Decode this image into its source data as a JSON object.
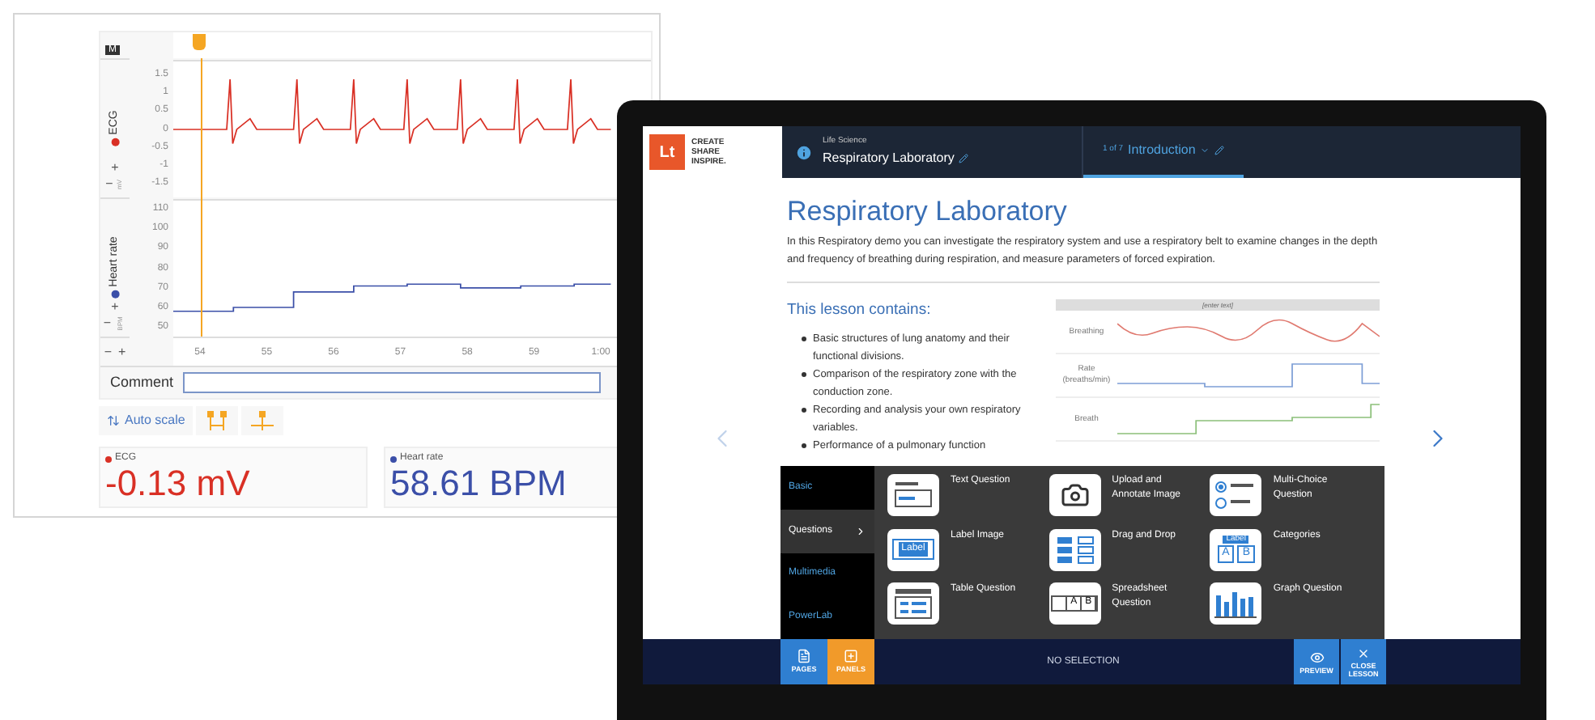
{
  "recorder": {
    "badge": "M",
    "ecg": {
      "color": "#d93025",
      "unit": "mV",
      "chart_data": {
        "type": "line",
        "x": [
          53.6,
          54.4,
          54.45,
          54.49,
          54.55,
          54.75,
          54.85,
          55.4,
          55.45,
          55.49,
          55.55,
          55.75,
          55.85,
          56.25,
          56.3,
          56.34,
          56.4,
          56.6,
          56.7,
          57.05,
          57.1,
          57.14,
          57.2,
          57.4,
          57.5,
          57.85,
          57.9,
          57.94,
          58.0,
          58.2,
          58.3,
          58.7,
          58.75,
          58.79,
          58.85,
          59.05,
          59.15,
          59.5,
          59.55,
          59.59,
          59.65,
          59.85,
          59.95,
          60.15
        ],
        "series": [
          {
            "name": "ECG",
            "color": "#d93025",
            "values": [
              0,
              0,
              1.4,
              -0.4,
              0,
              0.3,
              0,
              0,
              1.4,
              -0.4,
              0,
              0.3,
              0,
              0,
              1.4,
              -0.4,
              0,
              0.3,
              0,
              0,
              1.4,
              -0.4,
              0,
              0.3,
              0,
              0,
              1.4,
              -0.4,
              0,
              0.3,
              0,
              0,
              1.4,
              -0.4,
              0,
              0.3,
              0,
              0,
              1.4,
              -0.4,
              0,
              0.3,
              0,
              0
            ]
          }
        ],
        "xlim": [
          53.6,
          60.75
        ],
        "ylim": [
          -1.9,
          1.9
        ],
        "yticks": [
          1.5,
          1,
          0.5,
          0,
          -0.5,
          -1,
          -1.5
        ]
      }
    },
    "heart_rate": {
      "color": "#3b4fa8",
      "unit": "BPM",
      "chart_data": {
        "type": "line",
        "x": [
          53.6,
          54.5,
          54.5,
          55.4,
          55.4,
          56.3,
          56.3,
          57.1,
          57.1,
          57.9,
          57.9,
          58.8,
          58.8,
          59.6,
          59.6,
          60.15
        ],
        "series": [
          {
            "name": "Heart rate",
            "color": "#3b4fa8",
            "values": [
              58,
              58,
              60,
              60,
              68,
              68,
              71,
              71,
              72,
              72,
              70,
              70,
              71,
              71,
              72,
              72
            ]
          }
        ],
        "xlim": [
          53.6,
          60.75
        ],
        "ylim": [
          45,
          115
        ],
        "yticks": [
          110,
          100,
          90,
          80,
          70,
          60,
          50
        ],
        "xticks": [
          54,
          55,
          56,
          57,
          58,
          59,
          {
            "value": 60,
            "label": "1:00"
          }
        ]
      }
    },
    "zoom_minus": "−",
    "zoom_plus": "+",
    "channel_plus": "+",
    "channel_minus": "−",
    "comment_label": "Comment",
    "auto_scale": "Auto scale",
    "readouts": [
      {
        "name": "ECG",
        "color": "#d93025",
        "value": "-0.13 mV"
      },
      {
        "name": "Heart rate",
        "color": "#3b4fa8",
        "value": "58.61 BPM"
      }
    ]
  },
  "lesson": {
    "logo": "Lt",
    "tagline": [
      "CREATE",
      "SHARE",
      "INSPIRE."
    ],
    "subject": "Life Science",
    "title": "Respiratory Laboratory",
    "page_of": "1 of 7",
    "page_name": "Introduction",
    "heading": "Respiratory Laboratory",
    "intro": "In this Respiratory demo you can investigate the respiratory system and use a respiratory belt to examine changes in the depth and frequency of breathing during respiration, and measure parameters of forced expiration.",
    "contains_heading": "This lesson contains:",
    "bullets": [
      "Basic structures of lung anatomy and their functional divisions.",
      "Comparison of the respiratory zone with the conduction zone.",
      "Recording and analysis your own respiratory variables.",
      "Performance of a pulmonary function"
    ],
    "chart_caption": "[enter text]",
    "chart_rows": [
      "Breathing",
      "Rate (breaths/min)",
      "Breath"
    ],
    "panel_tabs": [
      {
        "label": "Basic",
        "selected": false
      },
      {
        "label": "Questions",
        "selected": true
      },
      {
        "label": "Multimedia",
        "selected": false
      },
      {
        "label": "PowerLab",
        "selected": false
      }
    ],
    "panel_items": [
      {
        "kind": "text",
        "label": "Text Question"
      },
      {
        "kind": "camera",
        "label": "Upload and Annotate Image"
      },
      {
        "kind": "choice",
        "label": "Multi-Choice Question"
      },
      {
        "kind": "label",
        "label": "Label Image",
        "tag": "Label"
      },
      {
        "kind": "drag",
        "label": "Drag and Drop"
      },
      {
        "kind": "categories",
        "label": "Categories",
        "tag": "Label",
        "cells": [
          "A",
          "B"
        ]
      },
      {
        "kind": "table",
        "label": "Table Question"
      },
      {
        "kind": "sheet",
        "label": "Spreadsheet Question",
        "cells": [
          "A",
          "B"
        ]
      },
      {
        "kind": "graph",
        "label": "Graph Question"
      }
    ],
    "bottom_left": [
      {
        "label": "PAGES",
        "kind": "pages",
        "selected": false
      },
      {
        "label": "PANELS",
        "kind": "panels",
        "selected": true
      }
    ],
    "status": "NO SELECTION",
    "bottom_right": [
      {
        "label": "PREVIEW",
        "kind": "preview"
      },
      {
        "label": "CLOSE LESSON",
        "kind": "close"
      }
    ]
  }
}
